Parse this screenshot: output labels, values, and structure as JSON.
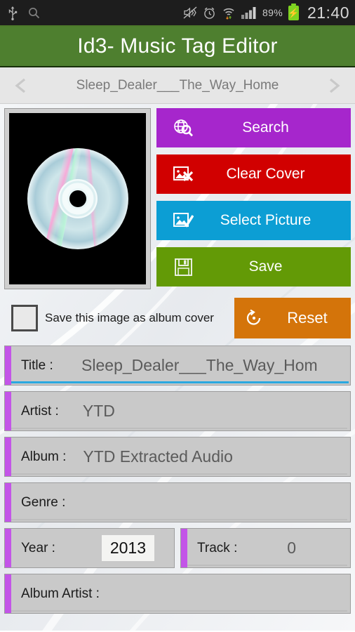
{
  "statusbar": {
    "icons_left": [
      "usb-icon",
      "search-icon"
    ],
    "icons_right": [
      "mute-icon",
      "alarm-icon",
      "wifi-icon",
      "signal-icon"
    ],
    "battery_percent": "89%",
    "battery_state": "charging",
    "clock": "21:40"
  },
  "appbar": {
    "title": "Id3- Music Tag Editor",
    "color": "#4e7f2f"
  },
  "navbar": {
    "prev_icon": "chevron-left-icon",
    "next_icon": "chevron-right-icon",
    "filename": "Sleep_Dealer___The_Way_Home"
  },
  "albumart": {
    "alt": "cd-disc-cover",
    "background": "#000000"
  },
  "buttons": [
    {
      "id": "search",
      "label": "Search",
      "icon": "globe-search-icon",
      "color": "#a626cc"
    },
    {
      "id": "clear",
      "label": "Clear Cover",
      "icon": "image-remove-icon",
      "color": "#d10000"
    },
    {
      "id": "select",
      "label": "Select Picture",
      "icon": "image-check-icon",
      "color": "#0c9ed4"
    },
    {
      "id": "save",
      "label": "Save",
      "icon": "floppy-disk-icon",
      "color": "#639a06"
    }
  ],
  "checkbox": {
    "label": "Save this image as album cover",
    "checked": false
  },
  "reset": {
    "label": "Reset",
    "icon": "rotate-ccw-icon",
    "color": "#d4740a"
  },
  "fields": [
    {
      "id": "title",
      "label": "Title :",
      "value": "Sleep_Dealer___The_Way_Hom",
      "focused": true,
      "placeholder": "Title"
    },
    {
      "id": "artist",
      "label": "Artist :",
      "value": "YTD",
      "focused": false,
      "placeholder": "Artist"
    },
    {
      "id": "album",
      "label": "Album :",
      "value": "YTD Extracted Audio",
      "focused": false,
      "placeholder": "Album"
    },
    {
      "id": "genre",
      "label": "Genre :",
      "value": "",
      "focused": false,
      "placeholder": "Genre"
    },
    {
      "id": "year",
      "label": "Year :",
      "value": "2013",
      "focused": false,
      "placeholder": "Year"
    },
    {
      "id": "track",
      "label": "Track :",
      "value": "0",
      "focused": false,
      "placeholder": "Track"
    },
    {
      "id": "album_artist",
      "label": "Album Artist :",
      "value": "",
      "focused": false,
      "placeholder": "Album Artist"
    }
  ],
  "theme": {
    "accent_purple": "#c355e8",
    "focus_blue": "#29a8e0",
    "field_bg": "#c9c9c9"
  }
}
